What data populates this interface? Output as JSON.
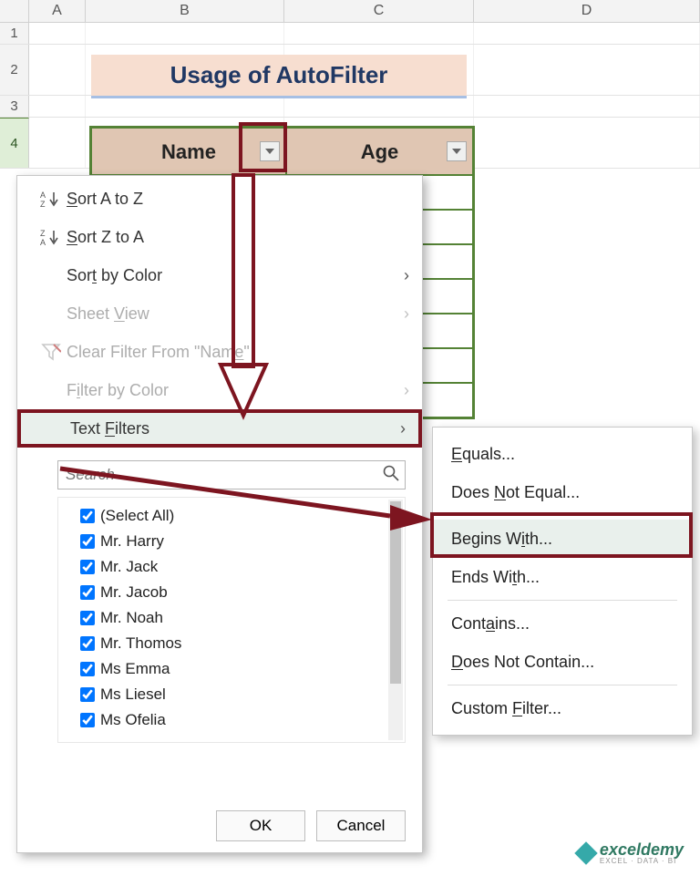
{
  "columns": {
    "A": "A",
    "B": "B",
    "C": "C",
    "D": "D"
  },
  "rows": [
    "1",
    "2",
    "3",
    "4"
  ],
  "title": "Usage of AutoFilter",
  "headers": {
    "name": "Name",
    "age": "Age"
  },
  "menu": {
    "sortAZ_pre": "S",
    "sortAZ_post": "ort A to Z",
    "sortZA_pre": "S",
    "sortZA_post": "ort Z to A",
    "sortColor_pre": "Sor",
    "sortColor_u": "t",
    "sortColor_post": " by Color",
    "sheetView_pre": "Sheet ",
    "sheetView_u": "V",
    "sheetView_post": "iew",
    "clear_pre": "Clear Filter From \"Nam",
    "clear_u": "e",
    "clear_post": "\"",
    "filterColor_pre": "F",
    "filterColor_u": "i",
    "filterColor_post": "lter by Color",
    "textFilters_pre": "Text ",
    "textFilters_u": "F",
    "textFilters_post": "ilters",
    "searchPlaceholder": "Search"
  },
  "items": [
    "(Select All)",
    "Mr. Harry",
    "Mr. Jack",
    "Mr. Jacob",
    "Mr. Noah",
    "Mr. Thomos",
    "Ms Emma",
    "Ms Liesel",
    "Ms Ofelia"
  ],
  "buttons": {
    "ok": "OK",
    "cancel": "Cancel"
  },
  "submenu": {
    "equals_u": "E",
    "equals_post": "quals...",
    "dne_pre": "Does ",
    "dne_u": "N",
    "dne_post": "ot Equal...",
    "begins_pre": "Begins W",
    "begins_u": "i",
    "begins_post": "th...",
    "ends_pre": "Ends Wi",
    "ends_u": "t",
    "ends_post": "h...",
    "contains_pre": "Cont",
    "contains_u": "a",
    "contains_post": "ins...",
    "dnc_pre": "",
    "dnc_u": "D",
    "dnc_post": "oes Not Contain...",
    "custom_pre": "Custom ",
    "custom_u": "F",
    "custom_post": "ilter..."
  },
  "watermark": {
    "brand": "exceldemy",
    "tag": "EXCEL · DATA · BI"
  }
}
